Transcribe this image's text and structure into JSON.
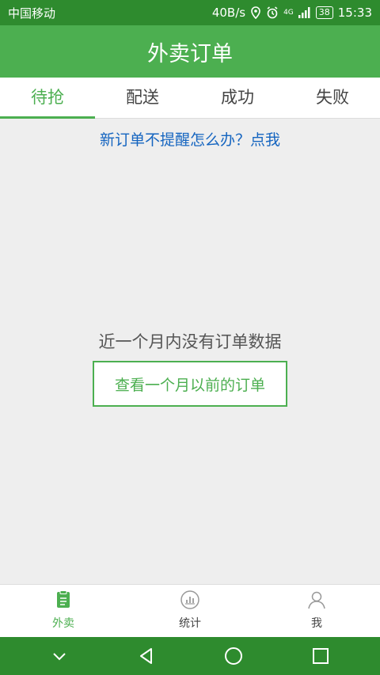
{
  "status_bar": {
    "carrier": "中国移动",
    "speed": "40B/s",
    "network": "4G",
    "battery": "38",
    "time": "15:33"
  },
  "title": "外卖订单",
  "tabs": [
    {
      "label": "待抢",
      "active": true
    },
    {
      "label": "配送",
      "active": false
    },
    {
      "label": "成功",
      "active": false
    },
    {
      "label": "失败",
      "active": false
    }
  ],
  "help_link": "新订单不提醒怎么办？点我",
  "empty_state": {
    "message": "近一个月内没有订单数据",
    "button": "查看一个月以前的订单"
  },
  "bottom_nav": [
    {
      "label": "外卖",
      "icon": "clipboard-icon",
      "active": true
    },
    {
      "label": "统计",
      "icon": "chart-icon",
      "active": false
    },
    {
      "label": "我",
      "icon": "person-icon",
      "active": false
    }
  ],
  "colors": {
    "primary": "#4caf50",
    "status_bar": "#2e8b2e",
    "link": "#1565c0"
  }
}
